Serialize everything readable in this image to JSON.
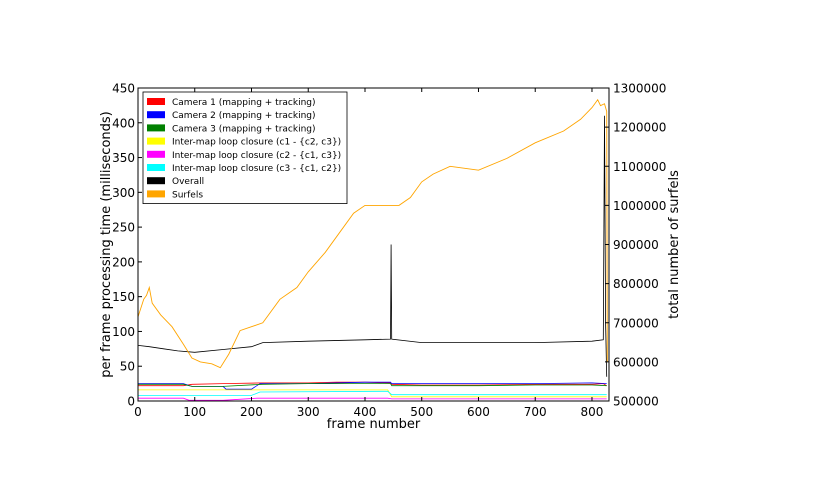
{
  "chart_data": {
    "type": "line",
    "title": "",
    "xlabel": "frame number",
    "ylabel": "per frame processing time (milliseconds)",
    "y2label": "total number of surfels",
    "xlim": [
      0,
      830
    ],
    "ylim": [
      0,
      450
    ],
    "y2lim": [
      500000,
      1300000
    ],
    "x_ticks": [
      "0",
      "100",
      "200",
      "300",
      "400",
      "500",
      "600",
      "700",
      "800"
    ],
    "y_ticks": [
      "0",
      "50",
      "100",
      "150",
      "200",
      "250",
      "300",
      "350",
      "400",
      "450"
    ],
    "y2_ticks": [
      "500000",
      "600000",
      "700000",
      "800000",
      "900000",
      "1000000",
      "1100000",
      "1200000",
      "1300000"
    ],
    "grid": false,
    "legend_position": "top-left",
    "series": [
      {
        "name": "Camera 1 (mapping + tracking)",
        "color": "#ff0000",
        "axis": "left",
        "points": [
          [
            0,
            22
          ],
          [
            80,
            22
          ],
          [
            95,
            24
          ],
          [
            150,
            25
          ],
          [
            220,
            26
          ],
          [
            300,
            26
          ],
          [
            350,
            27
          ],
          [
            400,
            27
          ],
          [
            445,
            26
          ],
          [
            447,
            24
          ],
          [
            500,
            23
          ],
          [
            600,
            23
          ],
          [
            700,
            24
          ],
          [
            800,
            24
          ],
          [
            820,
            25
          ],
          [
            826,
            22
          ]
        ]
      },
      {
        "name": "Camera 2 (mapping + tracking)",
        "color": "#0000ff",
        "axis": "left",
        "points": [
          [
            0,
            25
          ],
          [
            80,
            25
          ],
          [
            95,
            21
          ],
          [
            150,
            21
          ],
          [
            155,
            17
          ],
          [
            200,
            17
          ],
          [
            215,
            25
          ],
          [
            300,
            25
          ],
          [
            400,
            27
          ],
          [
            445,
            27
          ],
          [
            447,
            25
          ],
          [
            500,
            25
          ],
          [
            600,
            25
          ],
          [
            700,
            25
          ],
          [
            800,
            26
          ],
          [
            826,
            25
          ]
        ]
      },
      {
        "name": "Camera 3 (mapping + tracking)",
        "color": "#008000",
        "axis": "left",
        "points": [
          [
            0,
            24
          ],
          [
            80,
            24
          ],
          [
            95,
            21
          ],
          [
            150,
            21
          ],
          [
            220,
            24
          ],
          [
            300,
            25
          ],
          [
            400,
            25
          ],
          [
            445,
            25
          ],
          [
            447,
            22
          ],
          [
            500,
            22
          ],
          [
            600,
            22
          ],
          [
            700,
            23
          ],
          [
            800,
            23
          ],
          [
            826,
            22
          ]
        ]
      },
      {
        "name": "Inter-map loop closure (c1 - {c2, c3})",
        "color": "#ffff00",
        "axis": "left",
        "points": [
          [
            0,
            16
          ],
          [
            440,
            16
          ],
          [
            447,
            6
          ],
          [
            826,
            6
          ]
        ]
      },
      {
        "name": "Inter-map loop closure (c2 - {c1, c3})",
        "color": "#ff00ff",
        "axis": "left",
        "points": [
          [
            0,
            4
          ],
          [
            80,
            4
          ],
          [
            90,
            1
          ],
          [
            150,
            1
          ],
          [
            210,
            4
          ],
          [
            440,
            4
          ],
          [
            447,
            3
          ],
          [
            826,
            3
          ]
        ]
      },
      {
        "name": "Inter-map loop closure (c3 - {c1, c2})",
        "color": "#00ffff",
        "axis": "left",
        "points": [
          [
            0,
            8
          ],
          [
            200,
            8
          ],
          [
            215,
            13
          ],
          [
            440,
            14
          ],
          [
            447,
            9
          ],
          [
            826,
            9
          ]
        ]
      },
      {
        "name": "Overall",
        "color": "#000000",
        "axis": "left",
        "points": [
          [
            0,
            80
          ],
          [
            20,
            78
          ],
          [
            45,
            75
          ],
          [
            70,
            72
          ],
          [
            100,
            70
          ],
          [
            150,
            74
          ],
          [
            200,
            78
          ],
          [
            220,
            84
          ],
          [
            300,
            86
          ],
          [
            400,
            88
          ],
          [
            445,
            89
          ],
          [
            446,
            225
          ],
          [
            447,
            89
          ],
          [
            500,
            84
          ],
          [
            600,
            84
          ],
          [
            700,
            84
          ],
          [
            800,
            86
          ],
          [
            820,
            88
          ],
          [
            822,
            410
          ],
          [
            824,
            110
          ],
          [
            826,
            35
          ]
        ]
      },
      {
        "name": "Surfels",
        "color": "#ffa500",
        "axis": "right",
        "points": [
          [
            0,
            715000
          ],
          [
            10,
            760000
          ],
          [
            15,
            770000
          ],
          [
            20,
            790000
          ],
          [
            25,
            750000
          ],
          [
            40,
            720000
          ],
          [
            60,
            690000
          ],
          [
            80,
            645000
          ],
          [
            95,
            610000
          ],
          [
            110,
            600000
          ],
          [
            130,
            595000
          ],
          [
            145,
            585000
          ],
          [
            160,
            620000
          ],
          [
            180,
            680000
          ],
          [
            200,
            690000
          ],
          [
            220,
            700000
          ],
          [
            250,
            760000
          ],
          [
            280,
            790000
          ],
          [
            300,
            830000
          ],
          [
            330,
            880000
          ],
          [
            350,
            920000
          ],
          [
            380,
            980000
          ],
          [
            400,
            1000000
          ],
          [
            430,
            1000000
          ],
          [
            460,
            1000000
          ],
          [
            480,
            1020000
          ],
          [
            500,
            1060000
          ],
          [
            520,
            1080000
          ],
          [
            550,
            1100000
          ],
          [
            600,
            1090000
          ],
          [
            650,
            1120000
          ],
          [
            700,
            1160000
          ],
          [
            750,
            1190000
          ],
          [
            780,
            1220000
          ],
          [
            800,
            1250000
          ],
          [
            810,
            1270000
          ],
          [
            815,
            1255000
          ],
          [
            822,
            1260000
          ],
          [
            826,
            1240000
          ],
          [
            827,
            600000
          ]
        ]
      }
    ]
  }
}
